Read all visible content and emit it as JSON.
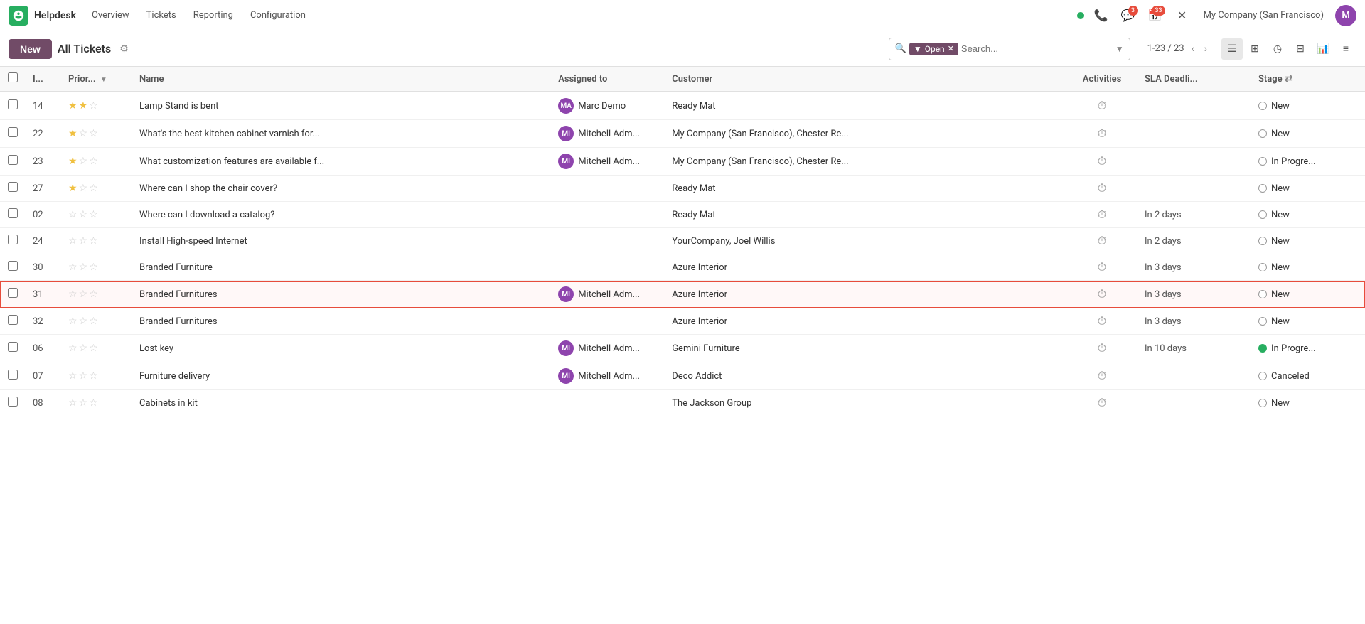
{
  "topnav": {
    "app": "Helpdesk",
    "items": [
      "Overview",
      "Tickets",
      "Reporting",
      "Configuration"
    ],
    "company": "My Company (San Francisco)",
    "badges": {
      "messages": "3",
      "calendar": "33"
    }
  },
  "toolbar": {
    "new_label": "New",
    "page_title": "All Tickets",
    "pagination": "1-23 / 23",
    "search_placeholder": "Search...",
    "filter_label": "Open"
  },
  "table": {
    "columns": [
      "I...",
      "Prior...",
      "Name",
      "Assigned to",
      "Customer",
      "Activities",
      "SLA Deadli...",
      "Stage"
    ],
    "rows": [
      {
        "id": "14",
        "priority": 2,
        "name": "Lamp Stand is bent",
        "assigned": "Marc Demo",
        "customer": "Ready Mat",
        "sla": "",
        "stage": "New",
        "stage_color": "gray",
        "highlighted": false
      },
      {
        "id": "22",
        "priority": 1,
        "name": "What's the best kitchen cabinet varnish for...",
        "assigned": "Mitchell Adm...",
        "customer": "My Company (San Francisco), Chester Re...",
        "sla": "",
        "stage": "New",
        "stage_color": "gray",
        "highlighted": false
      },
      {
        "id": "23",
        "priority": 1,
        "name": "What customization features are available f...",
        "assigned": "Mitchell Adm...",
        "customer": "My Company (San Francisco), Chester Re...",
        "sla": "",
        "stage": "In Progre...",
        "stage_color": "gray",
        "highlighted": false
      },
      {
        "id": "27",
        "priority": 1,
        "name": "Where can I shop the chair cover?",
        "assigned": "",
        "customer": "Ready Mat",
        "sla": "",
        "stage": "New",
        "stage_color": "gray",
        "highlighted": false
      },
      {
        "id": "02",
        "priority": 0,
        "name": "Where can I download a catalog?",
        "assigned": "",
        "customer": "Ready Mat",
        "sla": "In 2 days",
        "stage": "New",
        "stage_color": "gray",
        "highlighted": false
      },
      {
        "id": "24",
        "priority": 0,
        "name": "Install High-speed Internet",
        "assigned": "",
        "customer": "YourCompany, Joel Willis",
        "sla": "In 2 days",
        "stage": "New",
        "stage_color": "gray",
        "highlighted": false
      },
      {
        "id": "30",
        "priority": 0,
        "name": "Branded Furniture",
        "assigned": "",
        "customer": "Azure Interior",
        "sla": "In 3 days",
        "stage": "New",
        "stage_color": "gray",
        "highlighted": false
      },
      {
        "id": "31",
        "priority": 0,
        "name": "Branded Furnitures",
        "assigned": "Mitchell Adm...",
        "customer": "Azure Interior",
        "sla": "In 3 days",
        "stage": "New",
        "stage_color": "gray",
        "highlighted": true
      },
      {
        "id": "32",
        "priority": 0,
        "name": "Branded Furnitures",
        "assigned": "",
        "customer": "Azure Interior",
        "sla": "In 3 days",
        "stage": "New",
        "stage_color": "gray",
        "highlighted": false
      },
      {
        "id": "06",
        "priority": 0,
        "name": "Lost key",
        "assigned": "Mitchell Adm...",
        "customer": "Gemini Furniture",
        "sla": "In 10 days",
        "stage": "In Progre...",
        "stage_color": "green",
        "highlighted": false
      },
      {
        "id": "07",
        "priority": 0,
        "name": "Furniture delivery",
        "assigned": "Mitchell Adm...",
        "customer": "Deco Addict",
        "sla": "",
        "stage": "Canceled",
        "stage_color": "gray",
        "highlighted": false
      },
      {
        "id": "08",
        "priority": 0,
        "name": "Cabinets in kit",
        "assigned": "",
        "customer": "The Jackson Group",
        "sla": "",
        "stage": "New",
        "stage_color": "gray",
        "highlighted": false
      }
    ]
  }
}
